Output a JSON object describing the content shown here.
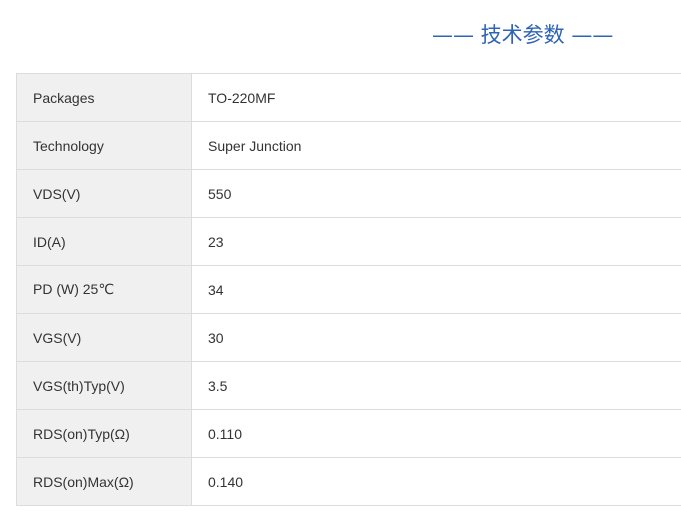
{
  "section": {
    "title": "—— 技术参数 ——"
  },
  "specs": [
    {
      "label": "Packages",
      "value": "TO-220MF"
    },
    {
      "label": "Technology",
      "value": "Super Junction"
    },
    {
      "label": "VDS(V)",
      "value": "550"
    },
    {
      "label": "ID(A)",
      "value": "23"
    },
    {
      "label": "PD (W) 25℃",
      "value": "34"
    },
    {
      "label": "VGS(V)",
      "value": "30"
    },
    {
      "label": "VGS(th)Typ(V)",
      "value": "3.5"
    },
    {
      "label": "RDS(on)Typ(Ω)",
      "value": "0.110"
    },
    {
      "label": "RDS(on)Max(Ω)",
      "value": "0.140"
    }
  ]
}
